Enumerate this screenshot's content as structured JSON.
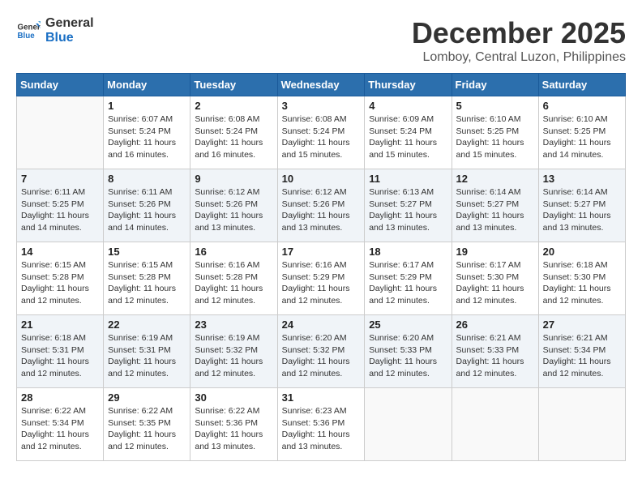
{
  "header": {
    "logo_line1": "General",
    "logo_line2": "Blue",
    "month": "December 2025",
    "location": "Lomboy, Central Luzon, Philippines"
  },
  "weekdays": [
    "Sunday",
    "Monday",
    "Tuesday",
    "Wednesday",
    "Thursday",
    "Friday",
    "Saturday"
  ],
  "weeks": [
    [
      {
        "day": "",
        "info": ""
      },
      {
        "day": "1",
        "info": "Sunrise: 6:07 AM\nSunset: 5:24 PM\nDaylight: 11 hours and 16 minutes."
      },
      {
        "day": "2",
        "info": "Sunrise: 6:08 AM\nSunset: 5:24 PM\nDaylight: 11 hours and 16 minutes."
      },
      {
        "day": "3",
        "info": "Sunrise: 6:08 AM\nSunset: 5:24 PM\nDaylight: 11 hours and 15 minutes."
      },
      {
        "day": "4",
        "info": "Sunrise: 6:09 AM\nSunset: 5:24 PM\nDaylight: 11 hours and 15 minutes."
      },
      {
        "day": "5",
        "info": "Sunrise: 6:10 AM\nSunset: 5:25 PM\nDaylight: 11 hours and 15 minutes."
      },
      {
        "day": "6",
        "info": "Sunrise: 6:10 AM\nSunset: 5:25 PM\nDaylight: 11 hours and 14 minutes."
      }
    ],
    [
      {
        "day": "7",
        "info": "Sunrise: 6:11 AM\nSunset: 5:25 PM\nDaylight: 11 hours and 14 minutes."
      },
      {
        "day": "8",
        "info": "Sunrise: 6:11 AM\nSunset: 5:26 PM\nDaylight: 11 hours and 14 minutes."
      },
      {
        "day": "9",
        "info": "Sunrise: 6:12 AM\nSunset: 5:26 PM\nDaylight: 11 hours and 13 minutes."
      },
      {
        "day": "10",
        "info": "Sunrise: 6:12 AM\nSunset: 5:26 PM\nDaylight: 11 hours and 13 minutes."
      },
      {
        "day": "11",
        "info": "Sunrise: 6:13 AM\nSunset: 5:27 PM\nDaylight: 11 hours and 13 minutes."
      },
      {
        "day": "12",
        "info": "Sunrise: 6:14 AM\nSunset: 5:27 PM\nDaylight: 11 hours and 13 minutes."
      },
      {
        "day": "13",
        "info": "Sunrise: 6:14 AM\nSunset: 5:27 PM\nDaylight: 11 hours and 13 minutes."
      }
    ],
    [
      {
        "day": "14",
        "info": "Sunrise: 6:15 AM\nSunset: 5:28 PM\nDaylight: 11 hours and 12 minutes."
      },
      {
        "day": "15",
        "info": "Sunrise: 6:15 AM\nSunset: 5:28 PM\nDaylight: 11 hours and 12 minutes."
      },
      {
        "day": "16",
        "info": "Sunrise: 6:16 AM\nSunset: 5:28 PM\nDaylight: 11 hours and 12 minutes."
      },
      {
        "day": "17",
        "info": "Sunrise: 6:16 AM\nSunset: 5:29 PM\nDaylight: 11 hours and 12 minutes."
      },
      {
        "day": "18",
        "info": "Sunrise: 6:17 AM\nSunset: 5:29 PM\nDaylight: 11 hours and 12 minutes."
      },
      {
        "day": "19",
        "info": "Sunrise: 6:17 AM\nSunset: 5:30 PM\nDaylight: 11 hours and 12 minutes."
      },
      {
        "day": "20",
        "info": "Sunrise: 6:18 AM\nSunset: 5:30 PM\nDaylight: 11 hours and 12 minutes."
      }
    ],
    [
      {
        "day": "21",
        "info": "Sunrise: 6:18 AM\nSunset: 5:31 PM\nDaylight: 11 hours and 12 minutes."
      },
      {
        "day": "22",
        "info": "Sunrise: 6:19 AM\nSunset: 5:31 PM\nDaylight: 11 hours and 12 minutes."
      },
      {
        "day": "23",
        "info": "Sunrise: 6:19 AM\nSunset: 5:32 PM\nDaylight: 11 hours and 12 minutes."
      },
      {
        "day": "24",
        "info": "Sunrise: 6:20 AM\nSunset: 5:32 PM\nDaylight: 11 hours and 12 minutes."
      },
      {
        "day": "25",
        "info": "Sunrise: 6:20 AM\nSunset: 5:33 PM\nDaylight: 11 hours and 12 minutes."
      },
      {
        "day": "26",
        "info": "Sunrise: 6:21 AM\nSunset: 5:33 PM\nDaylight: 11 hours and 12 minutes."
      },
      {
        "day": "27",
        "info": "Sunrise: 6:21 AM\nSunset: 5:34 PM\nDaylight: 11 hours and 12 minutes."
      }
    ],
    [
      {
        "day": "28",
        "info": "Sunrise: 6:22 AM\nSunset: 5:34 PM\nDaylight: 11 hours and 12 minutes."
      },
      {
        "day": "29",
        "info": "Sunrise: 6:22 AM\nSunset: 5:35 PM\nDaylight: 11 hours and 12 minutes."
      },
      {
        "day": "30",
        "info": "Sunrise: 6:22 AM\nSunset: 5:36 PM\nDaylight: 11 hours and 13 minutes."
      },
      {
        "day": "31",
        "info": "Sunrise: 6:23 AM\nSunset: 5:36 PM\nDaylight: 11 hours and 13 minutes."
      },
      {
        "day": "",
        "info": ""
      },
      {
        "day": "",
        "info": ""
      },
      {
        "day": "",
        "info": ""
      }
    ]
  ]
}
